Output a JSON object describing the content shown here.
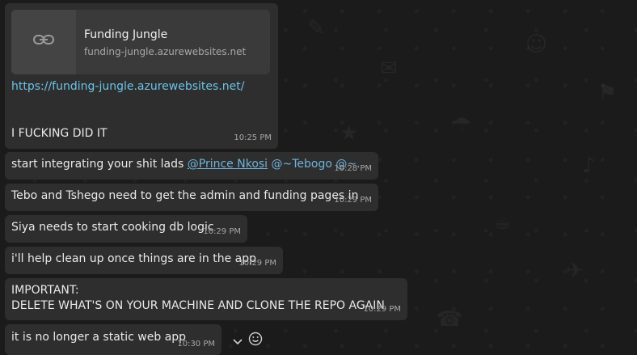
{
  "messages": [
    {
      "link_preview": {
        "title": "Funding Jungle",
        "url": "funding-jungle.azurewebsites.net"
      },
      "link": "https://funding-jungle.azurewebsites.net/",
      "text": "I FUCKING DID IT",
      "time": "10:25 PM"
    },
    {
      "text_prefix": "start integrating your shit lads ",
      "mention_1": "@Prince Nkosi",
      "mention_rest": " @~Tebogo @~.",
      "time": "10:28 PM"
    },
    {
      "text": "Tebo and Tshego need to get the admin and funding pages in",
      "time": "10:29 PM"
    },
    {
      "text": "Siya needs to start cooking db logic",
      "time": "10:29 PM"
    },
    {
      "text": "i'll help clean up once things are in the app",
      "time": "10:29 PM"
    },
    {
      "line1": "IMPORTANT:",
      "line2": "DELETE WHAT'S ON YOUR MACHINE AND CLONE THE REPO AGAIN",
      "time": "10:29 PM"
    },
    {
      "text": "it is no longer a static web app",
      "time": "10:30 PM"
    }
  ],
  "icons": {
    "link": "link-icon",
    "chevron": "chevron-down-icon",
    "react": "emoji-smile-icon"
  },
  "colors": {
    "background": "#1b1b1b",
    "bubble": "#2e2e2e",
    "preview": "#3a3a3a",
    "link": "#6cc2e8",
    "mention": "#6fb3dc",
    "timestamp": "#a7a7a7"
  }
}
